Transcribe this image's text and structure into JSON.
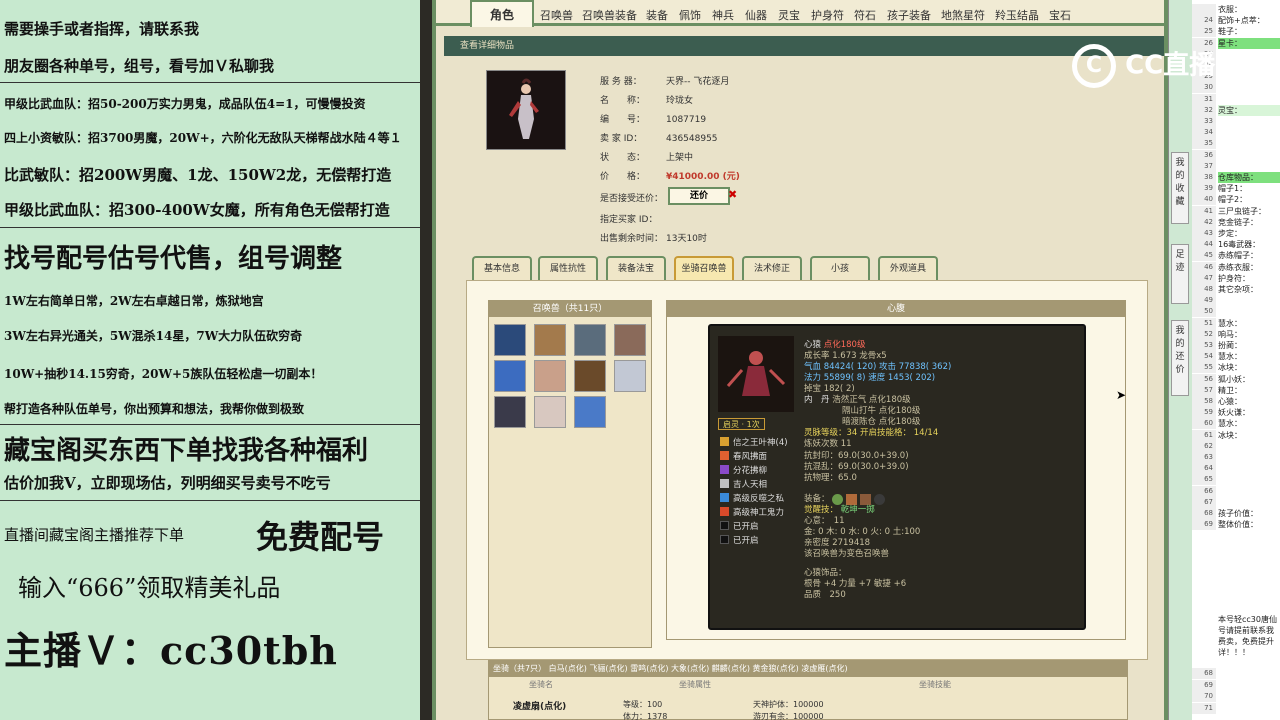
{
  "promo": {
    "lines": [
      "需要操手或者指挥，请联系我",
      "朋友圈各种单号，组号，看号加Ｖ私聊我",
      "甲级比武血队：招50-200万实力男鬼，成品队伍4=1，可慢慢投资",
      "四上小资敏队：招3700男魔，20W+，六阶化无敌队天梯帮战水陆４等１",
      "比武敏队：招200W男魔、1龙、150W2龙，无偿帮打造",
      "甲级比武血队：招300-400W女魔，所有角色无偿帮打造",
      "找号配号估号代售，组号调整",
      "1W左右简单日常，2W左右卓越日常，炼狱地宫",
      "3W左右异光通关，5W混杀14星，7W大力队伍砍穷奇",
      "10W+抽秒14.15穷奇，20W+5族队伍轻松虐一切副本！",
      "帮打造各种队伍单号，你出预算和想法，我帮你做到极致",
      "藏宝阁买东西下单找我各种福利",
      "估价加我V，立即现场估，列明细买号卖号不吃亏",
      "直播间藏宝阁主播推荐下单",
      "免费配号",
      "输入“666”领取精美礼品",
      "主播Ｖ：cc30tbh"
    ]
  },
  "game": {
    "tabs": [
      "角色",
      "召唤兽",
      "召唤兽装备",
      "装备",
      "佩饰",
      "神兵",
      "仙器",
      "灵宝",
      "护身符",
      "符石",
      "孩子装备",
      "地煞星符",
      "羚玉结晶",
      "宝石"
    ],
    "section_title": "查看详细物品",
    "info": {
      "server_label": "服 务 器：",
      "server": "天界-- 飞花逐月",
      "name_label": "名　　称：",
      "name": "玲珑女",
      "id_label": "编　　号：",
      "id": "1087719",
      "seller_label": "卖 家 ID：",
      "seller": "436548955",
      "status_label": "状　　态：",
      "status": "上架中",
      "price_label": "价　　格：",
      "price": "¥41000.00 (元)",
      "haggle_label": "是否接受还价：",
      "haggle_btn": "还价",
      "buyer_label": "指定买家 ID：",
      "time_label": "出售剩余时间：",
      "time": "13天10时"
    },
    "subtabs": [
      "基本信息",
      "属性抗性",
      "装备法宝",
      "坐骑召唤兽",
      "法术修正",
      "小孩",
      "外观道具"
    ],
    "pet_box_title": "召唤兽（共11只）",
    "heart_box_title": "心腹",
    "tooltip": {
      "l1a": "心猿",
      "l1b": "点化180级",
      "l2": "成长率 1.673 龙骨x5",
      "l3a": "气血 84424( 120)",
      "l3b": "攻击 77838( 362)",
      "l4a": "法力 55899( 8)",
      "l4b": "速度 1453( 202)",
      "l5": "掉宝 182( 2)",
      "l6a": "内　丹",
      "l6b": "浩然正气 点化180级",
      "l7": "隔山打牛 点化180级",
      "l8": "暗渡陈仓 点化180级",
      "l9a": "灵脉等级：",
      "l9b": "34 开启技能格：",
      "l9c": "14/14",
      "l10": "炼妖次数 11",
      "l11": "抗封印：69.0(30.0+39.0)",
      "l12": "抗混乱：69.0(30.0+39.0)",
      "l13": "抗物理：65.0",
      "l14": "装备：",
      "l15a": "觉醒技：",
      "l15b": "乾坤一掷",
      "l16": "心意：　11",
      "l17": "金: 0 木: 0 水: 0 火: 0 土:100",
      "l18": "亲密度 2719418",
      "l19": "该召唤兽为变色召唤兽",
      "l20": "心猿饰品：",
      "l21": "根骨 +4 力量 +7 敏捷 +6",
      "l22": "品质　250",
      "badge": "启灵 · 1次",
      "skills": [
        "信之王叶神(4)",
        "春风拂面",
        "分花拂柳",
        "吉人天相",
        "高级反噬之私",
        "高级神工鬼力",
        "已开启",
        "已开启"
      ]
    },
    "bottom": {
      "header": "坐骑（共7只）  白马(点化)  飞骊(点化)  雷鸣(点化)  大象(点化)  麒麟(点化)  黄金狼(点化)  凌虚雁(点化)",
      "cols": [
        "坐骑名",
        "坐骑属性",
        "坐骑技能"
      ],
      "row_name": "凌虚扇(点化)",
      "row_a": "等级：100",
      "row_b": "体力：1378",
      "row_c": "天神护体：100000",
      "row_d": "游刃有余：100000"
    }
  },
  "rail": [
    "我的收藏",
    "足迹",
    "我的还价"
  ],
  "sheet": {
    "cells": [
      {
        "n": "",
        "t": "衣服："
      },
      {
        "n": "24",
        "t": "配饰+点萃："
      },
      {
        "n": "25",
        "t": "鞋子："
      },
      {
        "n": "26",
        "t": "星卡：",
        "hl": true
      },
      {
        "n": "27",
        "t": ""
      },
      {
        "n": "28",
        "t": ""
      },
      {
        "n": "29",
        "t": ""
      },
      {
        "n": "30",
        "t": ""
      },
      {
        "n": "31",
        "t": ""
      },
      {
        "n": "32",
        "t": "灵宝：",
        "lt": true
      },
      {
        "n": "33",
        "t": ""
      },
      {
        "n": "34",
        "t": ""
      },
      {
        "n": "35",
        "t": ""
      },
      {
        "n": "36",
        "t": ""
      },
      {
        "n": "37",
        "t": ""
      },
      {
        "n": "38",
        "t": "仓库物品：",
        "hl": true
      },
      {
        "n": "39",
        "t": "帽子1："
      },
      {
        "n": "40",
        "t": "帽子2："
      },
      {
        "n": "41",
        "t": "三尸虫链子："
      },
      {
        "n": "42",
        "t": "竞金链子："
      },
      {
        "n": "43",
        "t": "步定："
      },
      {
        "n": "44",
        "t": "16毒武器："
      },
      {
        "n": "45",
        "t": "赤练帽子："
      },
      {
        "n": "46",
        "t": "赤练衣服："
      },
      {
        "n": "47",
        "t": "护身符："
      },
      {
        "n": "48",
        "t": "其它杂项："
      },
      {
        "n": "49",
        "t": ""
      },
      {
        "n": "50",
        "t": ""
      },
      {
        "n": "51",
        "t": "慧水："
      },
      {
        "n": "52",
        "t": "响马："
      },
      {
        "n": "53",
        "t": "扮蔺："
      },
      {
        "n": "54",
        "t": "慧水："
      },
      {
        "n": "55",
        "t": "冰块："
      },
      {
        "n": "56",
        "t": "狐小妖："
      },
      {
        "n": "57",
        "t": "精卫："
      },
      {
        "n": "58",
        "t": "心猿："
      },
      {
        "n": "59",
        "t": "妖火谦："
      },
      {
        "n": "60",
        "t": "慧水："
      },
      {
        "n": "61",
        "t": "冰块："
      },
      {
        "n": "62",
        "t": ""
      },
      {
        "n": "63",
        "t": ""
      },
      {
        "n": "64",
        "t": ""
      },
      {
        "n": "65",
        "t": ""
      },
      {
        "n": "66",
        "t": ""
      },
      {
        "n": "67",
        "t": ""
      },
      {
        "n": "68",
        "t": "孩子价值："
      },
      {
        "n": "69",
        "t": "整体价值："
      }
    ],
    "note": [
      "本号轻cc30唐仙",
      "号请提前联系我",
      "费卖，免费提升",
      "详！！！"
    ],
    "tail_nums": [
      "68",
      "69",
      "70",
      "71"
    ]
  },
  "logo": {
    "text": "CC直播",
    "mark": "C"
  }
}
